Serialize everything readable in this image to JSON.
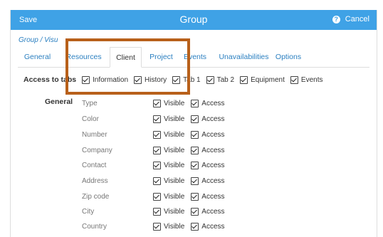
{
  "header": {
    "save_label": "Save",
    "title": "Group",
    "cancel_label": "Cancel",
    "help_icon": "question-circle-icon",
    "accent_color": "#3fa2e6"
  },
  "breadcrumb": "Group / Visu",
  "tabs": [
    {
      "label": "General"
    },
    {
      "label": "Resources"
    },
    {
      "label": "Client",
      "active": true
    },
    {
      "label": "Project"
    },
    {
      "label": "Events"
    },
    {
      "label": "Unavailabilities"
    },
    {
      "label": "Options"
    }
  ],
  "access_tabs": {
    "label": "Access to tabs",
    "options": [
      {
        "label": "Information",
        "checked": true
      },
      {
        "label": "History",
        "checked": true
      },
      {
        "label": "Tab 1",
        "checked": true
      },
      {
        "label": "Tab 2",
        "checked": true
      },
      {
        "label": "Equipment",
        "checked": true
      },
      {
        "label": "Events",
        "checked": true
      }
    ]
  },
  "general": {
    "title": "General",
    "visible_label": "Visible",
    "access_label": "Access",
    "fields": [
      {
        "name": "Type",
        "visible": true,
        "access": true
      },
      {
        "name": "Color",
        "visible": true,
        "access": true
      },
      {
        "name": "Number",
        "visible": true,
        "access": true
      },
      {
        "name": "Company",
        "visible": true,
        "access": true
      },
      {
        "name": "Contact",
        "visible": true,
        "access": true
      },
      {
        "name": "Address",
        "visible": true,
        "access": true
      },
      {
        "name": "Zip code",
        "visible": true,
        "access": true
      },
      {
        "name": "City",
        "visible": true,
        "access": true
      },
      {
        "name": "Country",
        "visible": true,
        "access": true
      }
    ]
  },
  "annotation_color": "#b8601a"
}
